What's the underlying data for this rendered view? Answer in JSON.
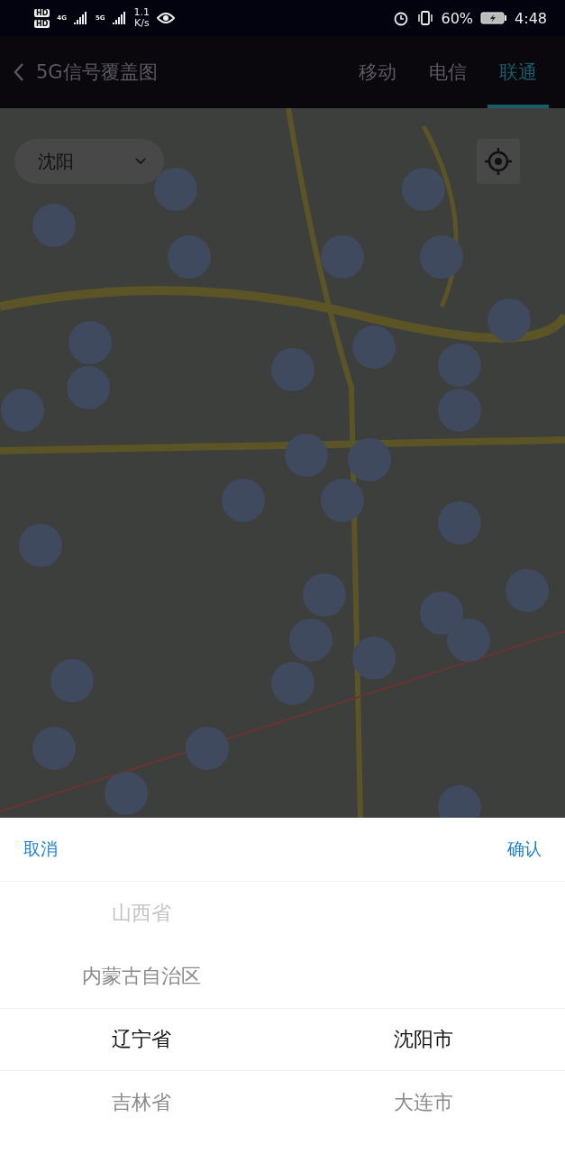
{
  "status_bar": {
    "hd_badges": [
      "HD",
      "HD"
    ],
    "networks": [
      "4G",
      "5G"
    ],
    "speed": [
      "1.1",
      "K/s"
    ],
    "battery": "60%",
    "time": "4:48"
  },
  "header": {
    "title": "5G信号覆盖图",
    "tabs": [
      {
        "label": "移动",
        "selected": false
      },
      {
        "label": "电信",
        "selected": false
      },
      {
        "label": "联通",
        "selected": true
      }
    ]
  },
  "map": {
    "city": "沈阳"
  },
  "picker": {
    "cancel": "取消",
    "confirm": "确认",
    "rows": [
      {
        "province": "山西省",
        "selected": false
      },
      {
        "province": "内蒙古自治区",
        "selected": false
      },
      {
        "province": "辽宁省",
        "city": "沈阳市",
        "selected": true
      },
      {
        "province": "吉林省",
        "city": "大连市",
        "selected": false
      }
    ]
  }
}
